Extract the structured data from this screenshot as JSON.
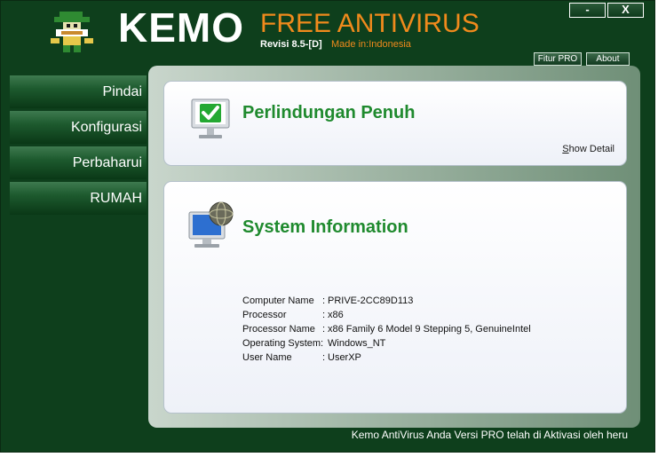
{
  "header": {
    "brand": "KEMO",
    "subtitle": "FREE ANTIVIRUS",
    "revisi": "Revisi 8.5-[D]",
    "made_in": "Made in:Indonesia"
  },
  "window_controls": {
    "minimize": "-",
    "close": "X"
  },
  "top_buttons": {
    "pro": "Fitur PRO",
    "about": "About"
  },
  "sidebar": {
    "items": [
      {
        "label": "Pindai"
      },
      {
        "label": "Konfigurasi"
      },
      {
        "label": "Perbaharui"
      },
      {
        "label": "RUMAH"
      }
    ]
  },
  "protection": {
    "title": "Perlindungan Penuh",
    "show_detail_first": "S",
    "show_detail_rest": "how Detail"
  },
  "system": {
    "title": "System Information",
    "rows": [
      {
        "label": "Computer Name",
        "sep": ":",
        "value": "PRIVE-2CC89D113"
      },
      {
        "label": "Processor",
        "sep": ":",
        "value": "x86"
      },
      {
        "label": "Processor Name",
        "sep": ":",
        "value": "x86 Family 6 Model 9 Stepping 5, GenuineIntel"
      },
      {
        "label": "Operating System",
        "sep": ":",
        "value": "Windows_NT"
      },
      {
        "label": "User Name",
        "sep": ":",
        "value": "UserXP"
      }
    ]
  },
  "status": "Kemo AntiVirus Anda Versi PRO telah di Aktivasi oleh heru",
  "colors": {
    "background": "#0e3f1c",
    "accent": "#f08a1c",
    "title_green": "#1f8a2e"
  }
}
